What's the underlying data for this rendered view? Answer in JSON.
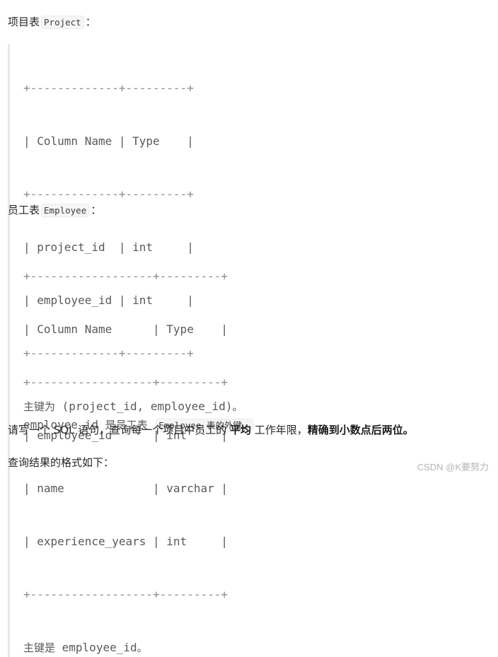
{
  "project_section": {
    "heading_prefix": "项目表",
    "heading_code": "Project",
    "heading_suffix": "：",
    "table_lines": [
      "+-------------+---------+",
      "| Column Name | Type    |",
      "+-------------+---------+",
      "| project_id  | int     |",
      "| employee_id | int     |",
      "+-------------+---------+"
    ],
    "note_pk_cn": "主键为",
    "note_pk_code": " (project_id, employee_id)",
    "note_pk_end": "。",
    "note_fk_code": "employee_id ",
    "note_fk_cn": "是员工表",
    "note_fk_inline": "Employee 表的外键。"
  },
  "employee_section": {
    "heading_prefix": "员工表",
    "heading_code": "Employee",
    "heading_suffix": "：",
    "table_lines": [
      "+------------------+---------+",
      "| Column Name      | Type    |",
      "+------------------+---------+",
      "| employee_id      | int     |",
      "| name             | varchar |",
      "| experience_years | int     |",
      "+------------------+---------+"
    ],
    "note_pk_cn": "主键是",
    "note_pk_code": " employee_id",
    "note_pk_end": "。"
  },
  "question": {
    "part1": "请写一个 SQL 语句，查询每一个项目中员工的 ",
    "bold1": "平均",
    "part2": " 工作年限，",
    "bold2": "精确到小数点后两位。"
  },
  "result_format": "查询结果的格式如下：",
  "watermark": "CSDN @K要努力"
}
